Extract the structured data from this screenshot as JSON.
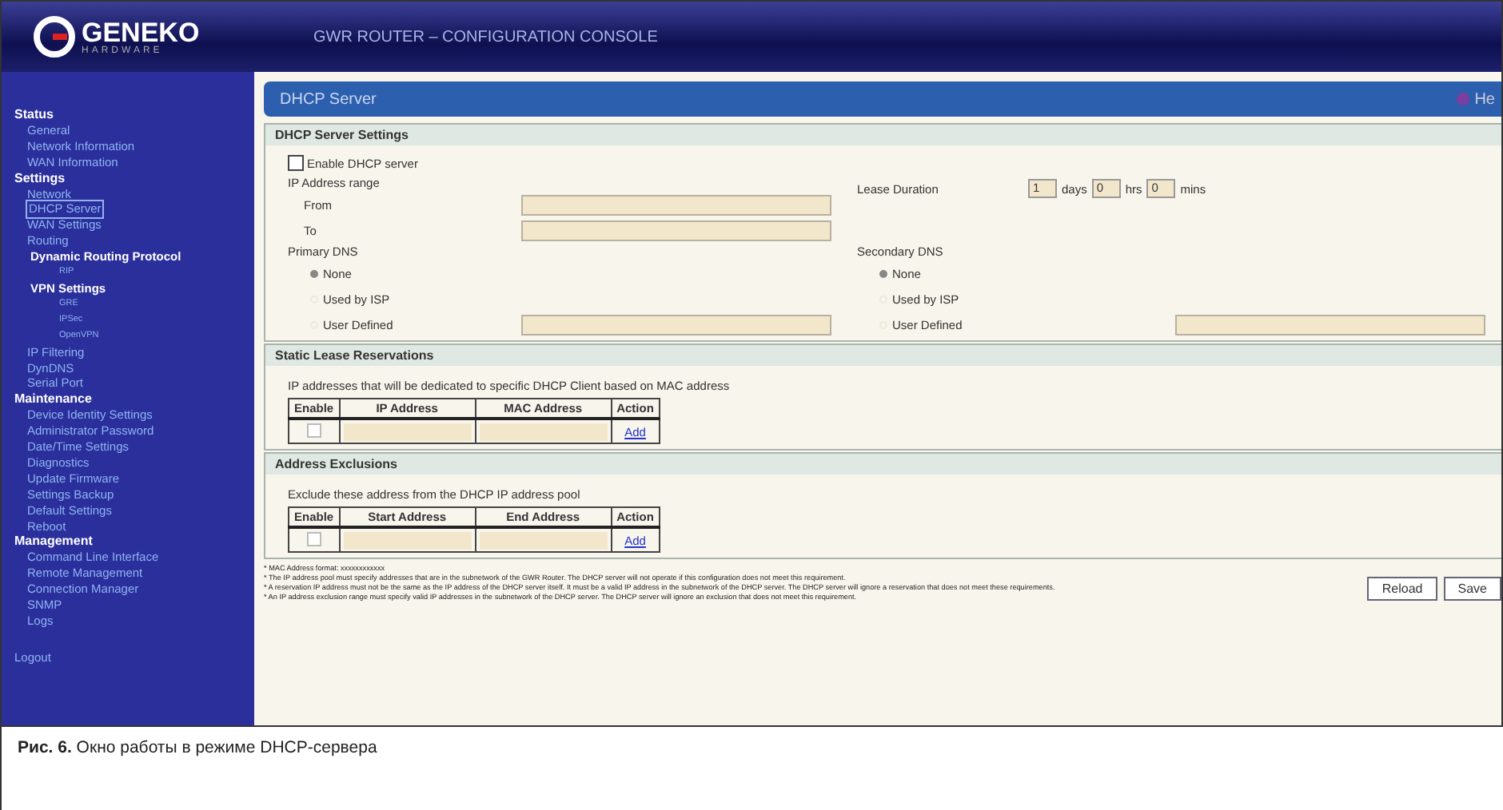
{
  "header": {
    "logo": "GENEKO",
    "logo_sub": "HARDWARE",
    "title": "GWR ROUTER – CONFIGURATION CONSOLE"
  },
  "sidebar": {
    "items": [
      {
        "kind": "section",
        "label": "Status",
        "selected": false
      },
      {
        "kind": "item",
        "label": "General",
        "selected": false
      },
      {
        "kind": "item",
        "label": "Network Information",
        "selected": false
      },
      {
        "kind": "item",
        "label": "WAN Information",
        "selected": false
      },
      {
        "kind": "section",
        "label": "Settings",
        "selected": false
      },
      {
        "kind": "item",
        "label": "Network",
        "selected": false
      },
      {
        "kind": "item",
        "label": "DHCP Server",
        "selected": true
      },
      {
        "kind": "item",
        "label": "WAN Settings",
        "selected": false
      },
      {
        "kind": "item",
        "label": "Routing",
        "selected": false
      },
      {
        "kind": "subsection",
        "label": "Dynamic Routing Protocol",
        "selected": false
      },
      {
        "kind": "subitem",
        "label": "RIP",
        "selected": false
      },
      {
        "kind": "subsection",
        "label": "VPN Settings",
        "selected": false
      },
      {
        "kind": "subitem",
        "label": "GRE",
        "selected": false
      },
      {
        "kind": "subitem",
        "label": "IPSec",
        "selected": false
      },
      {
        "kind": "subitem",
        "label": "OpenVPN",
        "selected": false
      },
      {
        "kind": "item",
        "label": "IP Filtering",
        "selected": false
      },
      {
        "kind": "item",
        "label": "DynDNS",
        "selected": false
      },
      {
        "kind": "item",
        "label": "Serial Port",
        "selected": false
      },
      {
        "kind": "section",
        "label": "Maintenance",
        "selected": false
      },
      {
        "kind": "item",
        "label": "Device Identity Settings",
        "selected": false
      },
      {
        "kind": "item",
        "label": "Administrator Password",
        "selected": false
      },
      {
        "kind": "item",
        "label": "Date/Time Settings",
        "selected": false
      },
      {
        "kind": "item",
        "label": "Diagnostics",
        "selected": false
      },
      {
        "kind": "item",
        "label": "Update Firmware",
        "selected": false
      },
      {
        "kind": "item",
        "label": "Settings Backup",
        "selected": false
      },
      {
        "kind": "item",
        "label": "Default Settings",
        "selected": false
      },
      {
        "kind": "item",
        "label": "Reboot",
        "selected": false
      },
      {
        "kind": "section",
        "label": "Management",
        "selected": false
      },
      {
        "kind": "item",
        "label": "Command Line Interface",
        "selected": false
      },
      {
        "kind": "item",
        "label": "Remote Management",
        "selected": false
      },
      {
        "kind": "item",
        "label": "Connection Manager",
        "selected": false
      },
      {
        "kind": "item",
        "label": "SNMP",
        "selected": false
      },
      {
        "kind": "item",
        "label": "Logs",
        "selected": false
      },
      {
        "kind": "logout",
        "label": "Logout",
        "selected": false
      }
    ]
  },
  "page": {
    "title": "DHCP Server",
    "help": "He"
  },
  "settings": {
    "title": "DHCP Server Settings",
    "enable": {
      "label": "Enable DHCP server",
      "checked": false
    },
    "range_label": "IP Address range",
    "from_label": "From",
    "to_label": "To",
    "lease": {
      "label": "Lease Duration",
      "days": "1",
      "days_unit": "days",
      "hrs": "0",
      "hrs_unit": "hrs",
      "mins": "0",
      "mins_unit": "mins"
    },
    "dns": [
      {
        "label": "Primary DNS",
        "options": [
          {
            "label": "None",
            "selected": true
          },
          {
            "label": "Used by ISP",
            "selected": false
          },
          {
            "label": "User Defined",
            "selected": false
          }
        ]
      },
      {
        "label": "Secondary DNS",
        "options": [
          {
            "label": "None",
            "selected": true
          },
          {
            "label": "Used by ISP",
            "selected": false
          },
          {
            "label": "User Defined",
            "selected": false
          }
        ]
      }
    ]
  },
  "tables": [
    {
      "title": "Static Lease Reservations",
      "note": "IP addresses that will be dedicated to specific DHCP Client based on MAC address",
      "columns": [
        "Enable",
        "IP Address",
        "MAC Address",
        "Action"
      ],
      "action": "Add",
      "checked": false
    },
    {
      "title": "Address Exclusions",
      "note": "Exclude these address from the DHCP IP address pool",
      "columns": [
        "Enable",
        "Start Address",
        "End Address",
        "Action"
      ],
      "action": "Add",
      "checked": false
    }
  ],
  "footnotes": [
    "* MAC Address format: xxxxxxxxxxxx",
    "* The IP address pool must specify addresses that are in the subnetwork of the GWR Router. The DHCP server will not operate if this configuration does not meet this requirement.",
    "* A reservation IP address must not be the same as the IP address of the DHCP server itself. It must be a valid IP address in the subnetwork of the DHCP server. The DHCP server will ignore a reservation that does not meet these requirements.",
    "* An IP address exclusion range must specify valid IP addresses in the subnetwork of the DHCP server. The DHCP server will ignore an exclusion that does not meet this requirement."
  ],
  "buttons": [
    "Reload",
    "Save"
  ],
  "caption": {
    "label": "Рис. 6.",
    "text": "Окно работы в режиме DHCP-сервера"
  }
}
